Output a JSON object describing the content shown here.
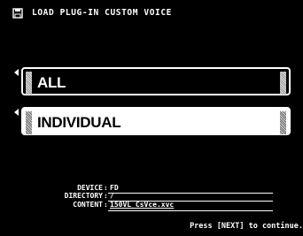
{
  "header": {
    "title": "LOAD PLUG-IN CUSTOM VOICE",
    "icon": "load-disk-icon"
  },
  "options": [
    {
      "label": "ALL",
      "selected": false
    },
    {
      "label": "INDIVIDUAL",
      "selected": true
    }
  ],
  "info": {
    "device_label": "DEVICE",
    "device_value": "FD",
    "directory_label": "DIRECTORY",
    "directory_value": "/",
    "content_label": "CONTENT",
    "content_value": "150VL CsVce.xvc",
    "separator": ":"
  },
  "footer": {
    "text": "Press [NEXT] to continue."
  }
}
